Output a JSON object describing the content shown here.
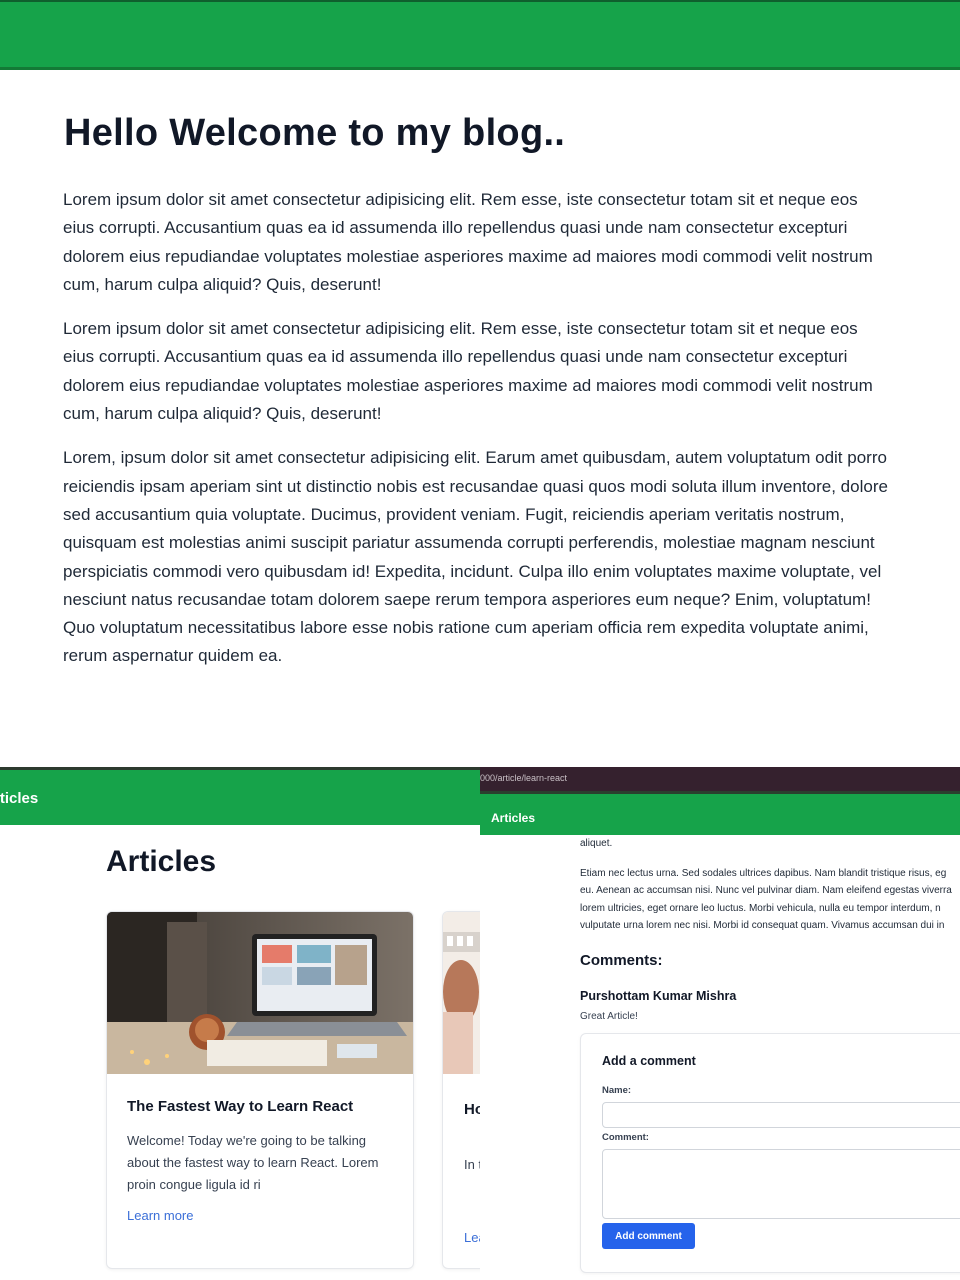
{
  "blog": {
    "title": "Hello Welcome to my blog..",
    "paragraphs": [
      "Lorem ipsum dolor sit amet consectetur adipisicing elit. Rem esse, iste consectetur totam sit et neque eos eius corrupti. Accusantium quas ea id assumenda illo repellendus quasi unde nam consectetur excepturi dolorem eius repudiandae voluptates molestiae asperiores maxime ad maiores modi commodi velit nostrum cum, harum culpa aliquid? Quis, deserunt!",
      "Lorem ipsum dolor sit amet consectetur adipisicing elit. Rem esse, iste consectetur totam sit et neque eos eius corrupti. Accusantium quas ea id assumenda illo repellendus quasi unde nam consectetur excepturi dolorem eius repudiandae voluptates molestiae asperiores maxime ad maiores modi commodi velit nostrum cum, harum culpa aliquid? Quis, deserunt!",
      "Lorem, ipsum dolor sit amet consectetur adipisicing elit. Earum amet quibusdam, autem voluptatum odit porro reiciendis ipsam aperiam sint ut distinctio nobis est recusandae quasi quos modi soluta illum inventore, dolore sed accusantium quia voluptate. Ducimus, provident veniam. Fugit, reiciendis aperiam veritatis nostrum, quisquam est molestias animi suscipit pariatur assumenda corrupti perferendis, molestiae magnam nesciunt perspiciatis commodi vero quibusdam id! Expedita, incidunt. Culpa illo enim voluptates maxime voluptate, vel nesciunt natus recusandae totam dolorem saepe rerum tempora asperiores eum neque? Enim, voluptatum! Quo voluptatum necessitatibus labore esse nobis ratione cum aperiam officia rem expedita voluptate animi, rerum aspernatur quidem ea."
    ]
  },
  "articles_list": {
    "nav_label": "rticles",
    "heading": "Articles",
    "cards": [
      {
        "title": "The Fastest Way to Learn React",
        "description": "Welcome! Today we're going to be talking about the fastest way to learn React. Lorem proin congue ligula id ri",
        "link": "Learn more"
      },
      {
        "title": "Ho Mi",
        "description": "In t loc No",
        "link": "Lea"
      }
    ]
  },
  "article_page": {
    "url": "000/article/learn-react",
    "nav_label": "Articles",
    "aliquet": "aliquet.",
    "paragraph_lines": [
      "Etiam nec lectus urna. Sed sodales ultrices dapibus. Nam blandit tristique risus, eg",
      "eu. Aenean ac accumsan nisi. Nunc vel pulvinar diam. Nam eleifend egestas viverra",
      "lorem ultricies, eget ornare leo luctus. Morbi vehicula, nulla eu tempor interdum, n",
      "vulputate urna lorem nec nisi. Morbi id consequat quam. Vivamus accumsan dui in"
    ],
    "comments_heading": "Comments:",
    "comment": {
      "author": "Purshottam Kumar Mishra",
      "text": "Great Article!"
    },
    "form": {
      "title": "Add a comment",
      "name_label": "Name:",
      "name_value": "",
      "comment_label": "Comment:",
      "comment_value": "",
      "submit_label": "Add comment"
    }
  },
  "colors": {
    "nav_green": "#16a34a",
    "url_bar": "#35212e",
    "link_blue": "#3b6fd8",
    "button_blue": "#2563eb"
  }
}
